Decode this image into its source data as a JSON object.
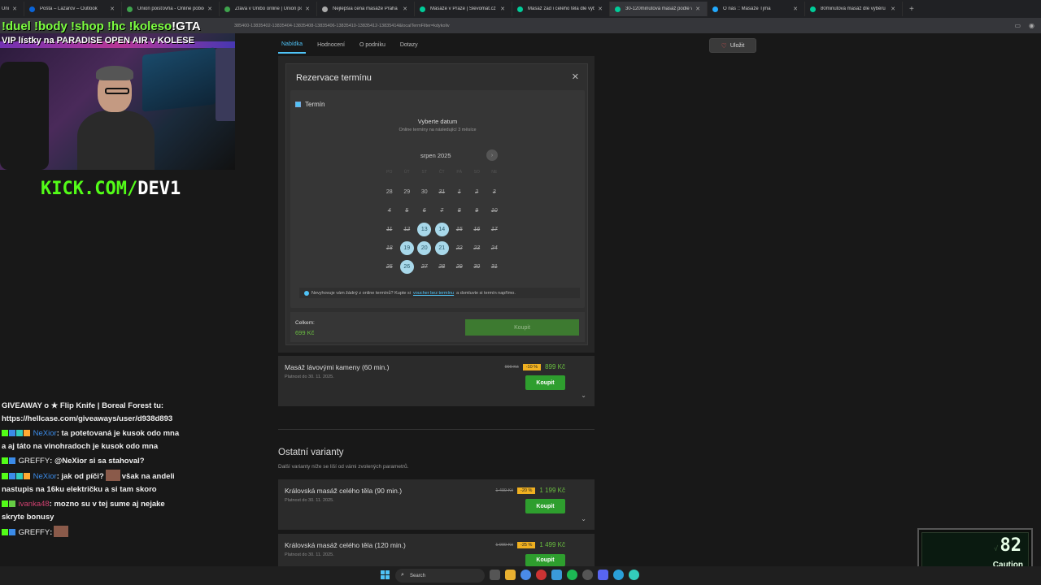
{
  "browser": {
    "tabs": [
      {
        "title": "Unib",
        "color": "#4a8"
      },
      {
        "title": "Pošta – Lazarov – Outlook",
        "color": "#0a64d8"
      },
      {
        "title": "Union poisťovňa - Online pobočka",
        "color": "#3fa34d"
      },
      {
        "title": "Zľava v Unibo online | Union poisťovňa",
        "color": "#3fa34d"
      },
      {
        "title": "Nejlepšia cena masáže Praha",
        "color": "#aaa"
      },
      {
        "title": "Masáže v Praze | Slevomat.cz",
        "color": "#0c9"
      },
      {
        "title": "Masáž zad i celého těla dle výběru",
        "color": "#0c9"
      },
      {
        "title": "30-120minutová masáž podle výběru",
        "color": "#0c9"
      },
      {
        "title": "O nás :: Masáže Tjma",
        "color": "#2af"
      },
      {
        "title": "80minutová masáž dle výběru",
        "color": "#0c9"
      }
    ],
    "active_tab": 7,
    "url": "385400-13835402-13835404-13835408-13835406-13835410-13835412-13835414&localTermFilter=kdykoliv"
  },
  "subnav": {
    "items": [
      "Nabídka",
      "Hodnocení",
      "O podniku",
      "Dotazy"
    ],
    "save_label": "Uložit"
  },
  "modal": {
    "title": "Rezervace termínu",
    "close": "✕",
    "termin_label": "Termín",
    "calendar_title": "Vyberte datum",
    "calendar_sub": "Online termíny na následující 3 měsíce",
    "month": "srpen 2025",
    "next": "›",
    "weekdays": [
      "PO",
      "ÚT",
      "ST",
      "ČT",
      "PÁ",
      "SO",
      "NE"
    ],
    "weeks": [
      [
        {
          "d": "28",
          "s": "norm"
        },
        {
          "d": "29",
          "s": "norm"
        },
        {
          "d": "30",
          "s": "norm"
        },
        {
          "d": "31",
          "s": "past"
        },
        {
          "d": "1",
          "s": "past"
        },
        {
          "d": "2",
          "s": "past"
        },
        {
          "d": "3",
          "s": "past"
        }
      ],
      [
        {
          "d": "4",
          "s": "past"
        },
        {
          "d": "5",
          "s": "past"
        },
        {
          "d": "6",
          "s": "past"
        },
        {
          "d": "7",
          "s": "past"
        },
        {
          "d": "8",
          "s": "past"
        },
        {
          "d": "9",
          "s": "past"
        },
        {
          "d": "10",
          "s": "past"
        }
      ],
      [
        {
          "d": "11",
          "s": "past"
        },
        {
          "d": "12",
          "s": "past"
        },
        {
          "d": "13",
          "s": "avail"
        },
        {
          "d": "14",
          "s": "avail"
        },
        {
          "d": "15",
          "s": "past"
        },
        {
          "d": "16",
          "s": "past"
        },
        {
          "d": "17",
          "s": "past"
        }
      ],
      [
        {
          "d": "18",
          "s": "past"
        },
        {
          "d": "19",
          "s": "avail"
        },
        {
          "d": "20",
          "s": "avail"
        },
        {
          "d": "21",
          "s": "avail"
        },
        {
          "d": "22",
          "s": "past"
        },
        {
          "d": "23",
          "s": "past"
        },
        {
          "d": "24",
          "s": "past"
        }
      ],
      [
        {
          "d": "25",
          "s": "past"
        },
        {
          "d": "26",
          "s": "avail"
        },
        {
          "d": "27",
          "s": "past"
        },
        {
          "d": "28",
          "s": "past"
        },
        {
          "d": "29",
          "s": "past"
        },
        {
          "d": "30",
          "s": "past"
        },
        {
          "d": "31",
          "s": "past"
        }
      ]
    ],
    "note_pre": "Nevyhovuje vám žádný z online termínů? Kupte si",
    "note_link": "voucher bez termínu",
    "note_post": "a domluvte si termín napřímo.",
    "total_label": "Celkem:",
    "total_price": "699 Kč",
    "buy_label": "Koupit"
  },
  "offers": [
    {
      "name": "Masáž lávovými kameny (60 min.)",
      "valid": "Platnost do 30. 11. 2025.",
      "old": "999 Kč",
      "discount": "-10 %",
      "price": "899 Kč",
      "buy": "Koupit"
    },
    {
      "name": "Královská masáž celého těla (90 min.)",
      "valid": "Platnost do 30. 11. 2025.",
      "old": "1 499 Kč",
      "discount": "-20 %",
      "price": "1 199 Kč",
      "buy": "Koupit"
    },
    {
      "name": "Královská masáž celého těla (120 min.)",
      "valid": "Platnost do 30. 11. 2025.",
      "old": "1 999 Kč",
      "discount": "-25 %",
      "price": "1 499 Kč",
      "buy": "Koupit"
    }
  ],
  "other_variants": {
    "title": "Ostatní varianty",
    "subtitle": "Další varianty níže se liší od vámi zvolených parametrů."
  },
  "stream": {
    "overlay_parts": [
      "!duel !body !shop !hc !koleso",
      "!GTA"
    ],
    "overlay_line2": "VIP lístky na PARADISE OPEN AIR v KOLESE",
    "kick_green": "KICK.COM/",
    "kick_white": "DEV1",
    "chat": [
      {
        "user": "",
        "text": "GIVEAWAY o ★ Flip Knife | Boreal Forest tu: https://hellcase.com/giveaways/user/d938d893",
        "color": "#eee"
      },
      {
        "user": "NeXior",
        "text": ": ta potetovaná je kusok odo mna a aj táto na vinohradoch je kusok odo mna",
        "color": "#3b8be8"
      },
      {
        "user": "GREFFY",
        "text": ": @NeXior si sa stahoval?",
        "color": "#eee"
      },
      {
        "user": "NeXior",
        "text": ": jak od píči?",
        "text2": "však na andeli nastupis na 16ku električku a si tam skoro",
        "color": "#3b8be8"
      },
      {
        "user": "ivanka48",
        "text": ": mozno su v tej sume aj nejake skryte bonusy",
        "color": "#d04070"
      },
      {
        "user": "GREFFY",
        "text": ":",
        "color": "#eee"
      }
    ],
    "gauge_value": "82",
    "gauge_label": "Caution"
  },
  "taskbar": {
    "search": "Search"
  }
}
